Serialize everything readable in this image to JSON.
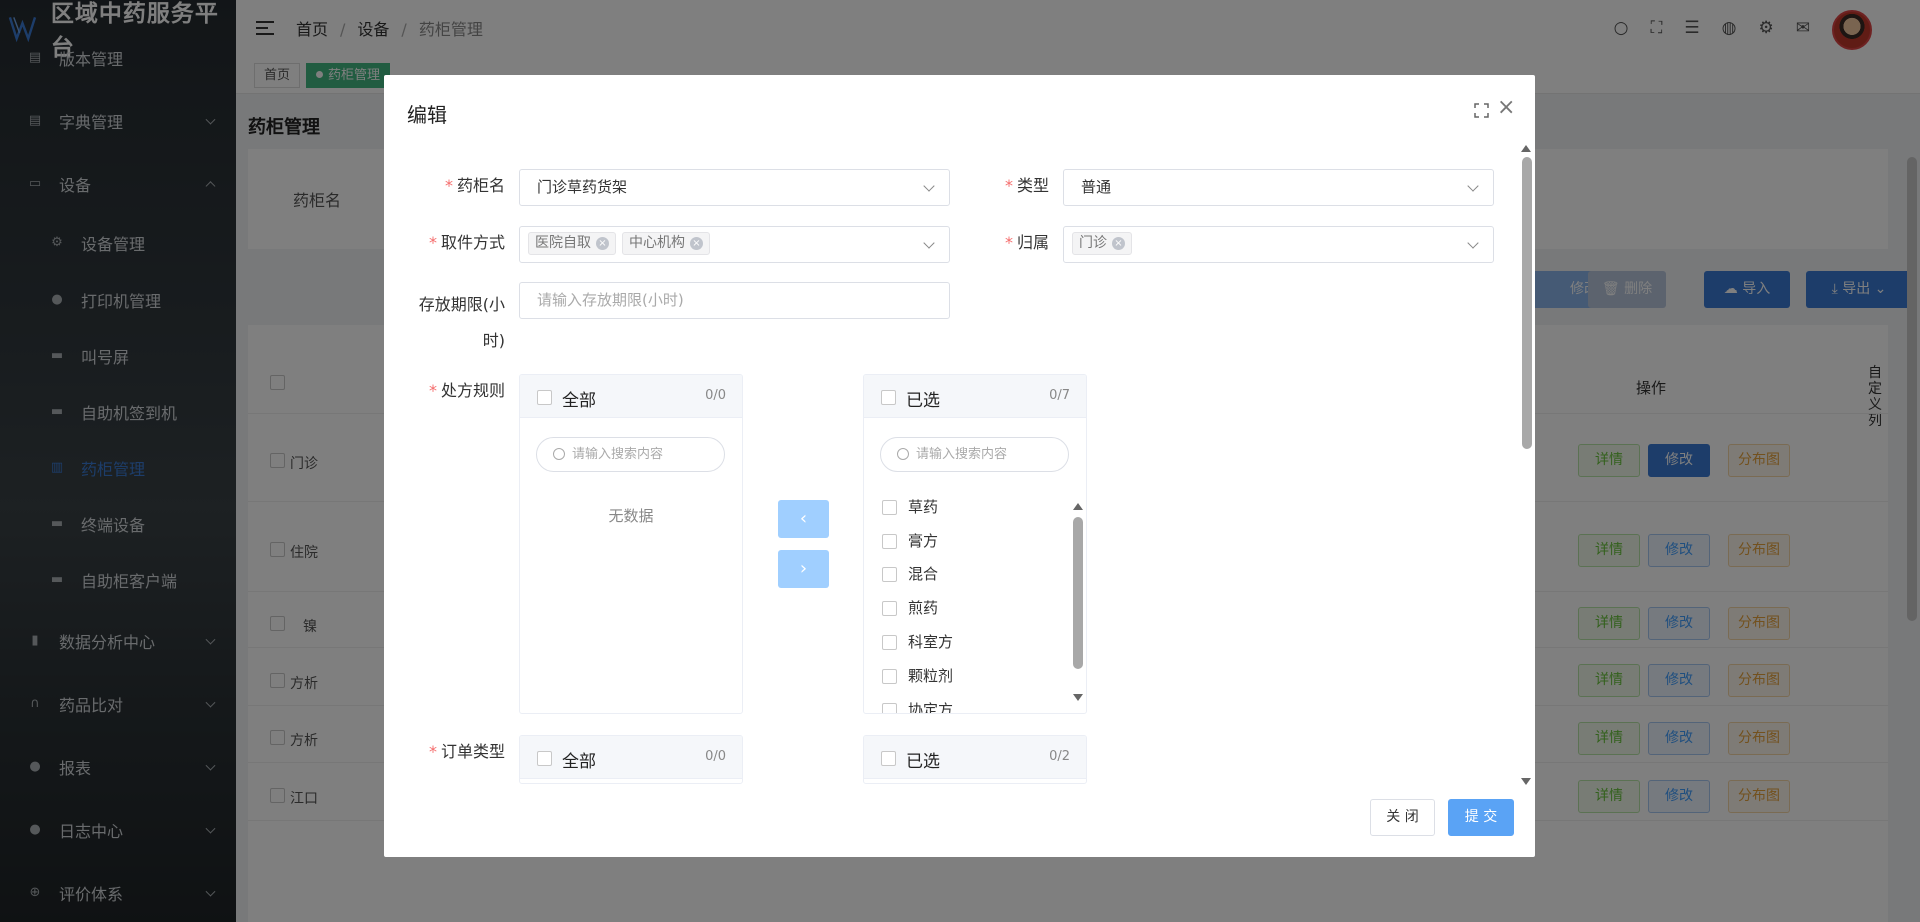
{
  "app": {
    "title": "区域中药服务平台"
  },
  "sidebar": {
    "items": [
      {
        "label": "版本管理",
        "icon": "doc-icon"
      },
      {
        "label": "字典管理",
        "icon": "book-icon"
      },
      {
        "label": "设备",
        "icon": "monitor-icon"
      },
      {
        "label": "设备管理",
        "icon": "gear-icon"
      },
      {
        "label": "打印机管理",
        "icon": "alert-icon"
      },
      {
        "label": "叫号屏",
        "icon": "monitor-icon"
      },
      {
        "label": "自助机签到机",
        "icon": "monitor-icon"
      },
      {
        "label": "药柜管理",
        "icon": "cabinet-icon"
      },
      {
        "label": "终端设备",
        "icon": "monitor-icon"
      },
      {
        "label": "自助柜客户端",
        "icon": "monitor-icon"
      },
      {
        "label": "数据分析中心",
        "icon": "chart-icon"
      },
      {
        "label": "药品比对",
        "icon": "headset-icon"
      },
      {
        "label": "报表",
        "icon": "user-icon"
      },
      {
        "label": "日志中心",
        "icon": "bulb-icon"
      },
      {
        "label": "评价体系",
        "icon": "plus-circle-icon"
      }
    ]
  },
  "breadcrumb": {
    "home": "首页",
    "level1": "设备",
    "current": "药柜管理"
  },
  "tabs": [
    {
      "label": "首页"
    },
    {
      "label": "药柜管理"
    }
  ],
  "page": {
    "title": "药柜管理",
    "search_label": "药柜名",
    "toolbar": {
      "edit": "修改",
      "delete": "删除",
      "import": "导入",
      "export": "导出"
    },
    "table": {
      "op_header": "操作",
      "custom_columns": "自定义列",
      "row_texts": [
        "门诊",
        "住院",
        "镍",
        "方析",
        "方析",
        "江口"
      ],
      "actions": {
        "detail": "详情",
        "edit": "修改",
        "layout": "分布图"
      }
    }
  },
  "dialog": {
    "title": "编辑",
    "fields": {
      "cabinet_name": {
        "label": "药柜名",
        "value": "门诊草药货架"
      },
      "type": {
        "label": "类型",
        "value": "普通"
      },
      "pickup": {
        "label": "取件方式",
        "tags": [
          "医院自取",
          "中心机构"
        ]
      },
      "owner": {
        "label": "归属",
        "tags": [
          "门诊"
        ]
      },
      "storage": {
        "label": "存放期限(小时)",
        "placeholder": "请输入存放期限(小时)"
      },
      "rx_rules": {
        "label": "处方规则"
      },
      "order_type": {
        "label": "订单类型"
      }
    },
    "rx_transfer": {
      "left": {
        "title": "全部",
        "count": "0/0",
        "search_placeholder": "请输入搜索内容",
        "empty": "无数据"
      },
      "right": {
        "title": "已选",
        "count": "0/7",
        "search_placeholder": "请输入搜索内容",
        "items": [
          "草药",
          "膏方",
          "混合",
          "煎药",
          "科室方",
          "颗粒剂",
          "协定方"
        ]
      }
    },
    "order_transfer": {
      "left": {
        "title": "全部",
        "count": "0/0"
      },
      "right": {
        "title": "已选",
        "count": "0/2"
      }
    },
    "buttons": {
      "close": "关 闭",
      "submit": "提 交"
    }
  }
}
